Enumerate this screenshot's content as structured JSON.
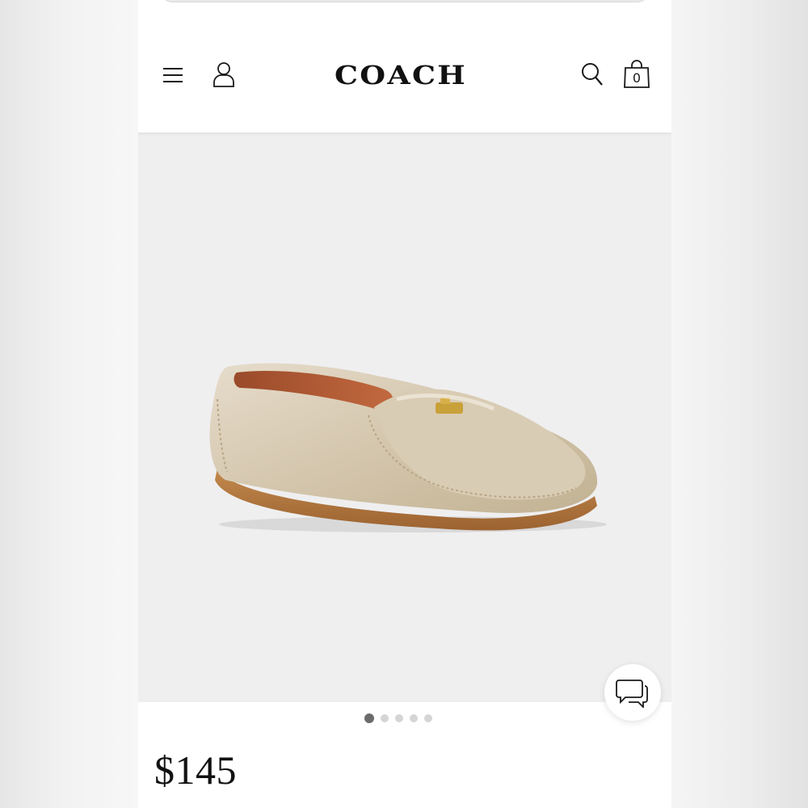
{
  "header": {
    "brand": "COACH",
    "cart_count": "0"
  },
  "icons": {
    "menu": "hamburger-menu-icon",
    "account": "user-account-icon",
    "search": "search-icon",
    "bag": "shopping-bag-icon",
    "chat": "chat-bubbles-icon"
  },
  "gallery": {
    "image_count": 5,
    "active_index": 0
  },
  "product": {
    "price": "$145"
  },
  "colors": {
    "gallery_background": "#efeff0",
    "active_dot": "#6b6b6b",
    "inactive_dot": "#d5d5d5"
  }
}
